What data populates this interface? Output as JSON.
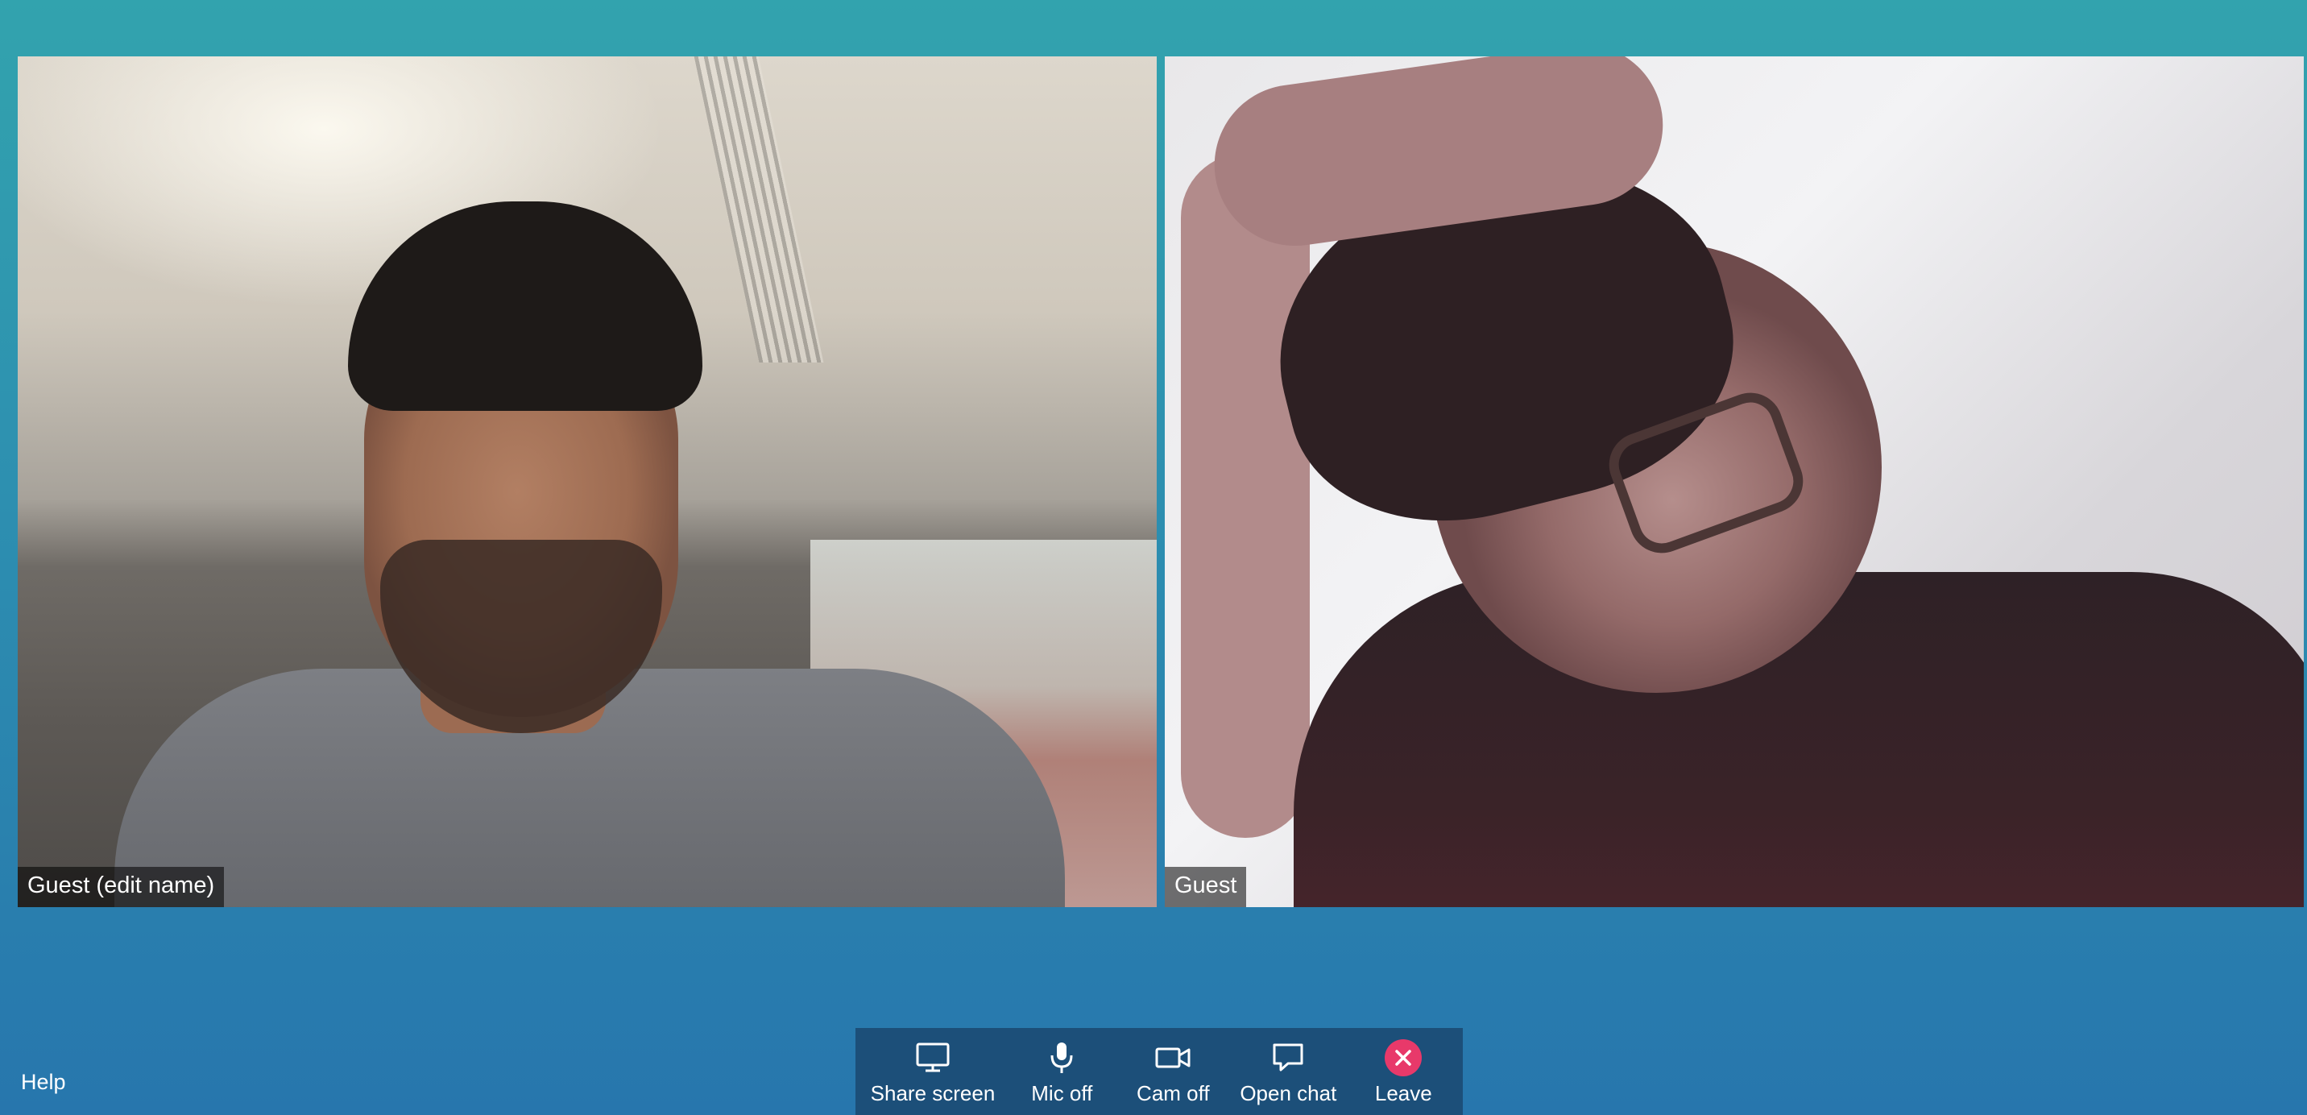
{
  "videos": [
    {
      "name_label": "Guest (edit name)"
    },
    {
      "name_label": "Guest"
    }
  ],
  "help": {
    "label": "Help"
  },
  "toolbar": {
    "share_screen": {
      "label": "Share screen",
      "icon": "monitor-icon"
    },
    "mic": {
      "label": "Mic off",
      "icon": "microphone-icon"
    },
    "cam": {
      "label": "Cam off",
      "icon": "video-camera-icon"
    },
    "chat": {
      "label": "Open chat",
      "icon": "chat-bubble-icon"
    },
    "leave": {
      "label": "Leave",
      "icon": "close-icon"
    }
  },
  "colors": {
    "background_top": "#32a3ae",
    "background_bottom": "#2776ad",
    "toolbar": "#1c4f79",
    "leave_accent": "#e8396a"
  }
}
